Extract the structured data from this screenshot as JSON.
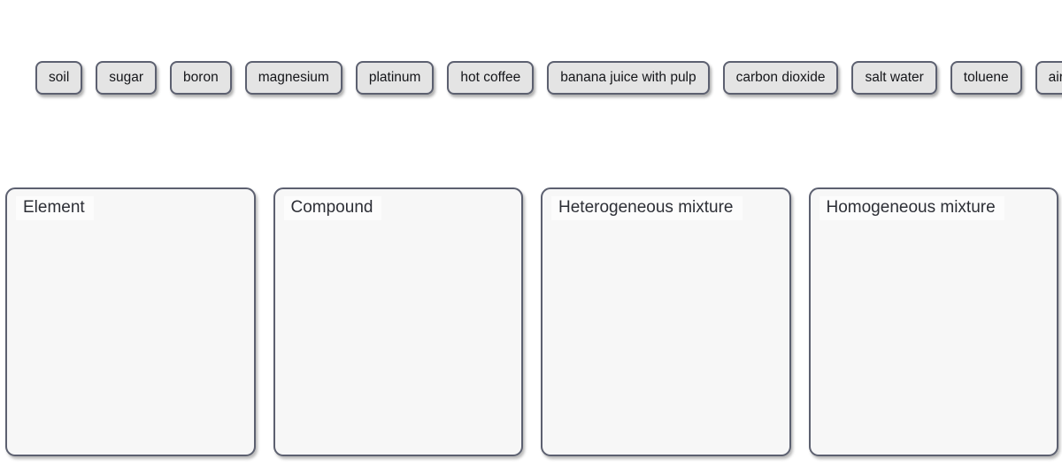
{
  "exercise": {
    "tokens": [
      {
        "label": "soil"
      },
      {
        "label": "sugar"
      },
      {
        "label": "boron"
      },
      {
        "label": "magnesium"
      },
      {
        "label": "platinum"
      },
      {
        "label": "hot coffee"
      },
      {
        "label": "banana juice with pulp"
      },
      {
        "label": "carbon dioxide"
      },
      {
        "label": "salt water"
      },
      {
        "label": "toluene"
      },
      {
        "label": "air"
      }
    ],
    "dropzones": [
      {
        "label": "Element",
        "items": []
      },
      {
        "label": "Compound",
        "items": []
      },
      {
        "label": "Heterogeneous mixture",
        "items": []
      },
      {
        "label": "Homogeneous mixture",
        "items": []
      }
    ]
  },
  "colors": {
    "page_background": "#ffffff",
    "token_fill": "#e4e4e4",
    "token_border": "#5c6070",
    "token_text": "#15161a",
    "dropzone_fill": "#f7f7f7",
    "dropzone_label_fill": "#fcfcfc",
    "dropzone_border": "#5c6070",
    "dropzone_label_text": "#2d2f36"
  }
}
